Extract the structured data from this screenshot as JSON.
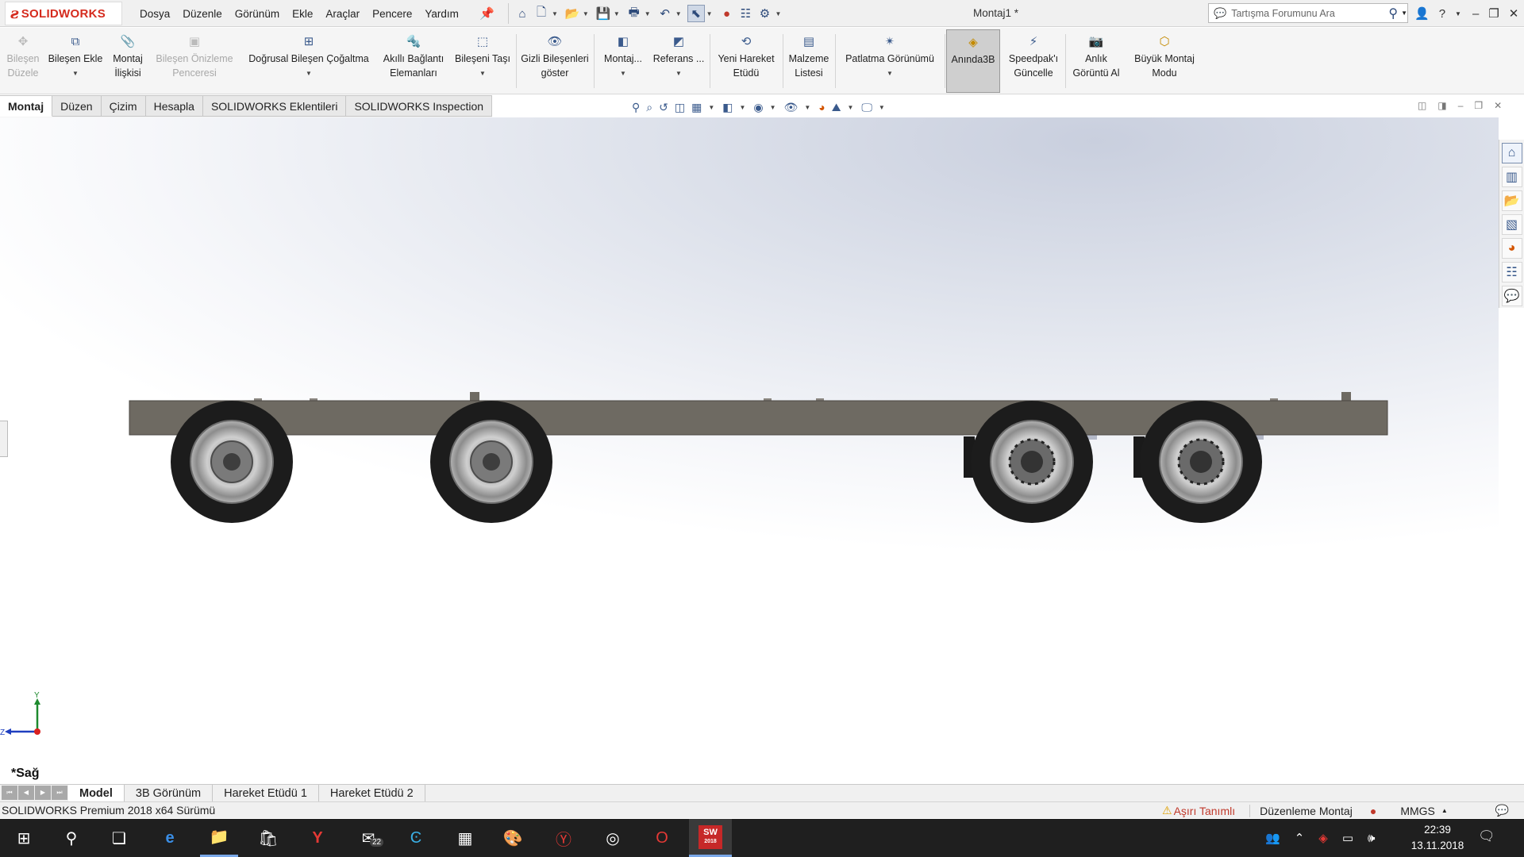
{
  "app": {
    "logo_text": "SOLIDWORKS",
    "document_title": "Montaj1 *"
  },
  "menu": [
    "Dosya",
    "Düzenle",
    "Görünüm",
    "Ekle",
    "Araçlar",
    "Pencere",
    "Yardım"
  ],
  "search": {
    "placeholder": "Tartışma Forumunu Ara"
  },
  "ribbon": {
    "edit_component": "Bileşen Düzele",
    "insert_component": "Bileşen Ekle",
    "mate": "Montaj İlişkisi",
    "component_preview": "Bileşen Önizleme Penceresi",
    "linear_pattern": "Doğrusal Bileşen Çoğaltma",
    "smart_fasteners": "Akıllı Bağlantı Elemanları",
    "move_component": "Bileşeni Taşı",
    "show_hidden": "Gizli Bileşenleri göster",
    "assembly_features": "Montaj...",
    "reference_geometry": "Referans ...",
    "new_motion_study": "Yeni Hareket Etüdü",
    "bill_of_materials": "Malzeme Listesi",
    "exploded_view": "Patlatma Görünümü",
    "instant3d": "Anında3B",
    "update_speedpak": "Speedpak'ı Güncelle",
    "take_snapshot": "Anlık Görüntü Al",
    "large_assembly_mode": "Büyük Montaj Modu"
  },
  "command_tabs": [
    "Montaj",
    "Düzen",
    "Çizim",
    "Hesapla",
    "SOLIDWORKS Eklentileri",
    "SOLIDWORKS Inspection"
  ],
  "viewport": {
    "view_name": "*Sağ",
    "triad": {
      "y": "Y",
      "z": "Z"
    }
  },
  "bottom_tabs": [
    "Model",
    "3B Görünüm",
    "Hareket Etüdü 1",
    "Hareket Etüdü 2"
  ],
  "status": {
    "version": "SOLIDWORKS Premium 2018 x64 Sürümü",
    "over_defined": "Aşırı Tanımlı",
    "mode": "Düzenleme Montaj",
    "units": "MMGS"
  },
  "taskbar": {
    "mail_badge": "22",
    "sw_label": "SW",
    "sw_year": "2018",
    "time": "22:39",
    "date": "13.11.2018"
  },
  "colors": {
    "brand": "#d52b1e",
    "chassis": "#6e6a62",
    "tire": "#1c1c1c",
    "rim": "#a9a9a9"
  }
}
